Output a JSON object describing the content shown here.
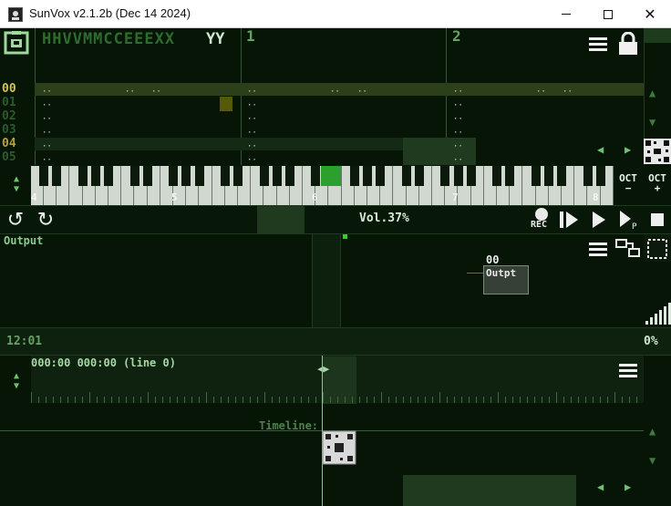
{
  "window": {
    "title": "SunVox v2.1.2b (Dec 14 2024)",
    "close_glyph": "✕"
  },
  "pattern": {
    "title": "HHVVMMCCEEEXX",
    "title_hi": "YY",
    "tracks": [
      "1",
      "2"
    ],
    "rows": [
      "00",
      "01",
      "02",
      "03",
      "04",
      "05"
    ],
    "cell": "··"
  },
  "keyboard": {
    "octaves": [
      "4",
      "5",
      "6",
      "7",
      "8"
    ],
    "oct_minus": "OCT\n−",
    "oct_plus": "OCT\n+"
  },
  "transport": {
    "volume": "Vol.37%",
    "rec": "REC"
  },
  "modules": {
    "label": "Output",
    "output_number": "00",
    "output_name": "Outpt"
  },
  "status": {
    "time": "12:01",
    "cpu": "0%"
  },
  "timeline": {
    "position": "000:00 000:00 (line 0)",
    "caption": "Timeline:"
  },
  "icons": {
    "undo": "undo-icon",
    "redo": "redo-icon",
    "menu": "menu-icon",
    "lock": "lock-icon"
  }
}
